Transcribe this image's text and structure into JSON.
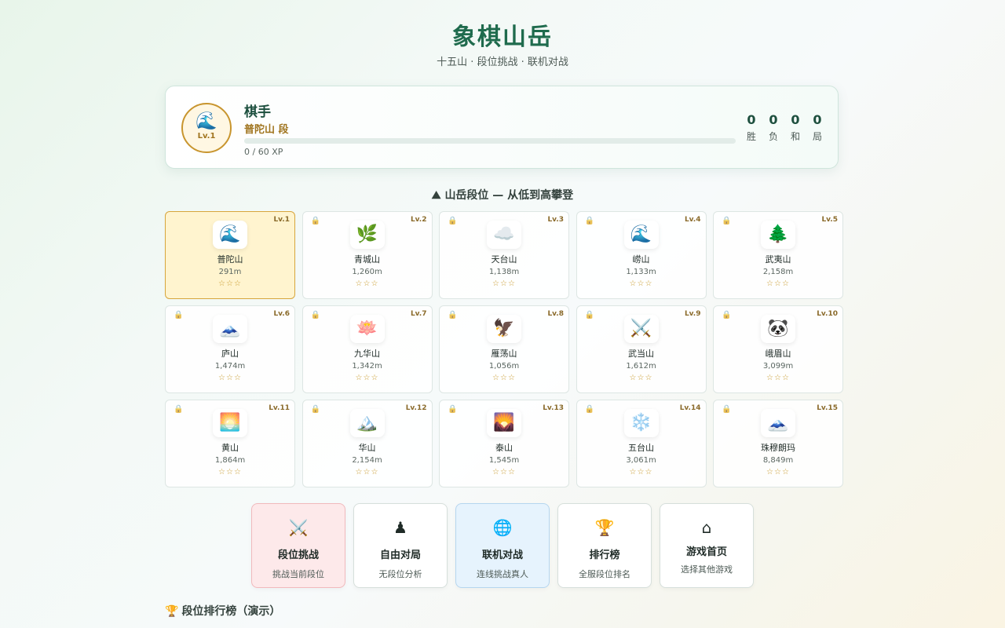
{
  "header": {
    "title": "象棋山岳",
    "subtitle": "十五山 · 段位挑战 · 联机对战"
  },
  "profile": {
    "avatar_icon": "🌊",
    "level": "Lv.1",
    "name": "棋手",
    "rank": "普陀山 段",
    "xp_text": "0 / 60 XP",
    "xp_progress": 0,
    "stats": [
      {
        "value": "0",
        "label": "胜"
      },
      {
        "value": "0",
        "label": "负"
      },
      {
        "value": "0",
        "label": "和"
      },
      {
        "value": "0",
        "label": "局"
      }
    ]
  },
  "mountains_section": {
    "icon": "⛰",
    "title": "山岳段位 — 从低到高攀登"
  },
  "mountains": [
    {
      "level": "Lv.1",
      "icon": "🌊",
      "name": "普陀山",
      "altitude": "291m",
      "stars": "☆☆☆",
      "current": true,
      "locked": false
    },
    {
      "level": "Lv.2",
      "icon": "🌿",
      "name": "青城山",
      "altitude": "1,260m",
      "stars": "☆☆☆",
      "current": false,
      "locked": true
    },
    {
      "level": "Lv.3",
      "icon": "☁️",
      "name": "天台山",
      "altitude": "1,138m",
      "stars": "☆☆☆",
      "current": false,
      "locked": true
    },
    {
      "level": "Lv.4",
      "icon": "🌊",
      "name": "崂山",
      "altitude": "1,133m",
      "stars": "☆☆☆",
      "current": false,
      "locked": true
    },
    {
      "level": "Lv.5",
      "icon": "🌲",
      "name": "武夷山",
      "altitude": "2,158m",
      "stars": "☆☆☆",
      "current": false,
      "locked": true
    },
    {
      "level": "Lv.6",
      "icon": "🗻",
      "name": "庐山",
      "altitude": "1,474m",
      "stars": "☆☆☆",
      "current": false,
      "locked": true
    },
    {
      "level": "Lv.7",
      "icon": "🪷",
      "name": "九华山",
      "altitude": "1,342m",
      "stars": "☆☆☆",
      "current": false,
      "locked": true
    },
    {
      "level": "Lv.8",
      "icon": "🦅",
      "name": "雁荡山",
      "altitude": "1,056m",
      "stars": "☆☆☆",
      "current": false,
      "locked": true
    },
    {
      "level": "Lv.9",
      "icon": "⚔️",
      "name": "武当山",
      "altitude": "1,612m",
      "stars": "☆☆☆",
      "current": false,
      "locked": true
    },
    {
      "level": "Lv.10",
      "icon": "🐼",
      "name": "峨眉山",
      "altitude": "3,099m",
      "stars": "☆☆☆",
      "current": false,
      "locked": true
    },
    {
      "level": "Lv.11",
      "icon": "🌅",
      "name": "黄山",
      "altitude": "1,864m",
      "stars": "☆☆☆",
      "current": false,
      "locked": true
    },
    {
      "level": "Lv.12",
      "icon": "🏔️",
      "name": "华山",
      "altitude": "2,154m",
      "stars": "☆☆☆",
      "current": false,
      "locked": true
    },
    {
      "level": "Lv.13",
      "icon": "🌄",
      "name": "泰山",
      "altitude": "1,545m",
      "stars": "☆☆☆",
      "current": false,
      "locked": true
    },
    {
      "level": "Lv.14",
      "icon": "❄️",
      "name": "五台山",
      "altitude": "3,061m",
      "stars": "☆☆☆",
      "current": false,
      "locked": true
    },
    {
      "level": "Lv.15",
      "icon": "🗻",
      "name": "珠穆朗玛",
      "altitude": "8,849m",
      "stars": "☆☆☆",
      "current": false,
      "locked": true
    }
  ],
  "lock_icon": "🔒",
  "actions": [
    {
      "icon": "⚔️",
      "label": "段位挑战",
      "desc": "挑战当前段位"
    },
    {
      "icon": "♟",
      "label": "自由对局",
      "desc": "无段位分析"
    },
    {
      "icon": "🌐",
      "label": "联机对战",
      "desc": "连线挑战真人"
    },
    {
      "icon": "🏆",
      "label": "排行榜",
      "desc": "全服段位排名"
    },
    {
      "icon": "⌂",
      "label": "游戏首页",
      "desc": "选择其他游戏"
    }
  ],
  "leaderboard": {
    "icon": "🏆",
    "title": "段位排行榜（演示）"
  },
  "colors": {
    "accent": "#1f6b4d",
    "gold": "#c8952e",
    "current_card_bg": "#fff4cf",
    "challenge_bg": "#fde9ea",
    "online_bg": "#e6f3fd"
  }
}
